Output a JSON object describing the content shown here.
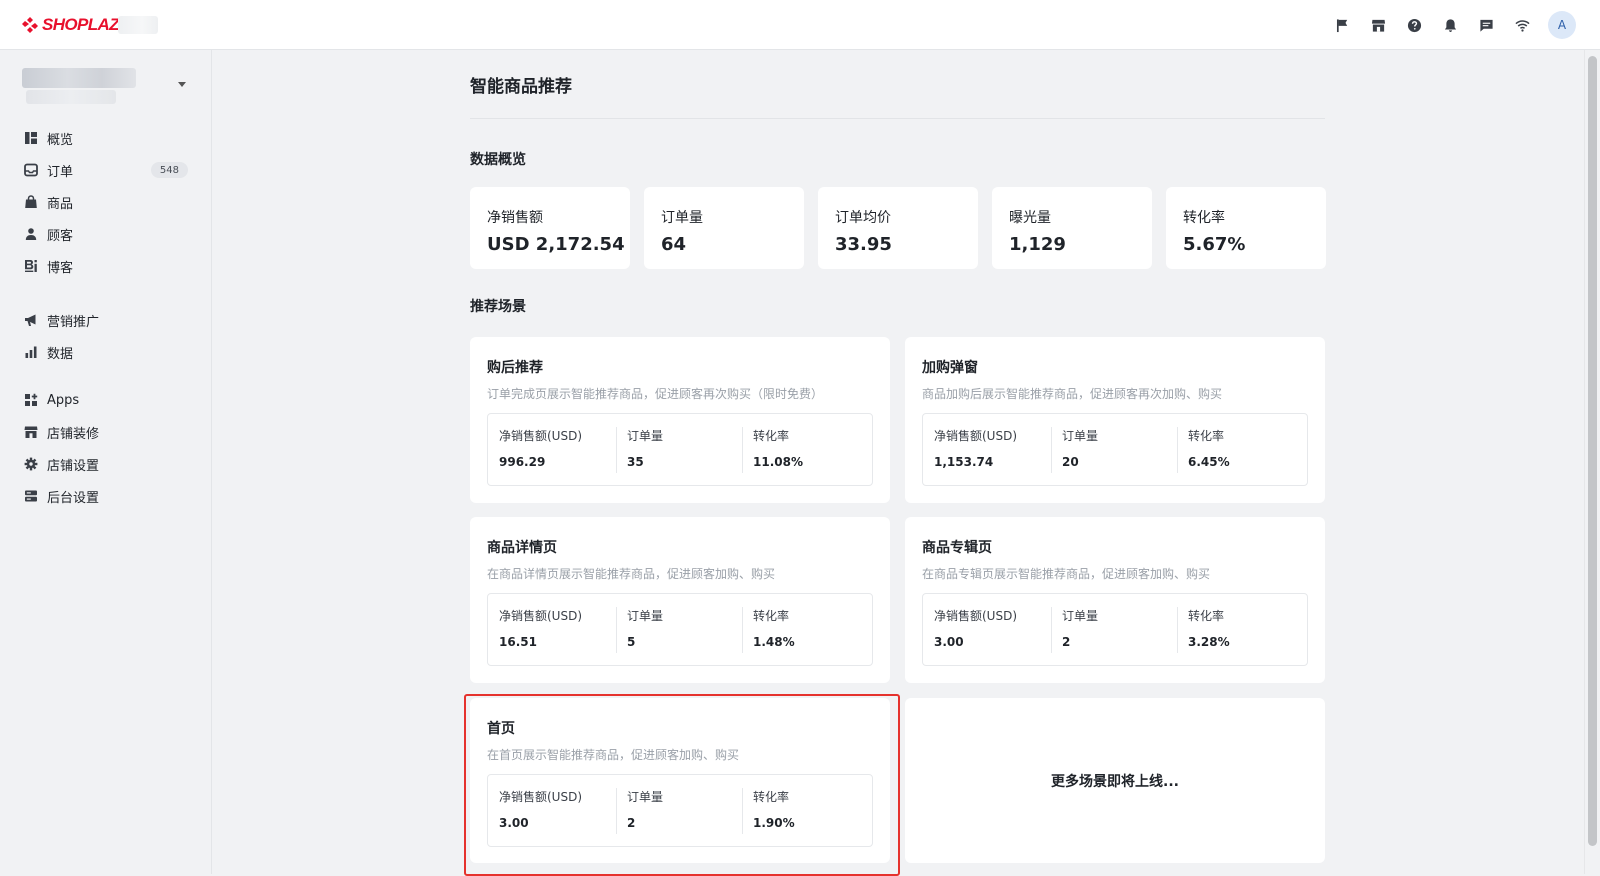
{
  "header": {
    "logo_text": "SHOPLAZZA",
    "brand_color": "#e8112d",
    "icons": [
      "flag-icon",
      "store-icon",
      "help-icon",
      "bell-icon",
      "chat-icon",
      "wifi-icon"
    ],
    "avatar_initial": "A"
  },
  "sidebar": {
    "groups": [
      [
        {
          "label": "概览",
          "icon": "overview-icon"
        },
        {
          "label": "订单",
          "icon": "inbox-icon",
          "badge": "548"
        },
        {
          "label": "商品",
          "icon": "bag-icon"
        },
        {
          "label": "顾客",
          "icon": "person-icon"
        },
        {
          "label": "博客",
          "icon": "blog-icon"
        }
      ],
      [
        {
          "label": "营销推广",
          "icon": "megaphone-icon"
        },
        {
          "label": "数据",
          "icon": "bar-chart-icon"
        }
      ],
      [
        {
          "label": "Apps",
          "icon": "apps-icon"
        },
        {
          "label": "店铺装修",
          "icon": "storefront-icon"
        },
        {
          "label": "店铺设置",
          "icon": "gear-icon"
        },
        {
          "label": "后台设置",
          "icon": "server-icon"
        }
      ]
    ]
  },
  "main": {
    "title": "智能商品推荐",
    "overview": {
      "title": "数据概览",
      "metrics": [
        {
          "label": "净销售额",
          "value": "USD 2,172.54"
        },
        {
          "label": "订单量",
          "value": "64"
        },
        {
          "label": "订单均价",
          "value": "33.95"
        },
        {
          "label": "曝光量",
          "value": "1,129"
        },
        {
          "label": "转化率",
          "value": "5.67%"
        }
      ]
    },
    "scenes": {
      "title": "推荐场景",
      "items": [
        {
          "title": "购后推荐",
          "desc": "订单完成页展示智能推荐商品，促进顾客再次购买（限时免费）",
          "stats": [
            {
              "label": "净销售额(USD)",
              "value": "996.29"
            },
            {
              "label": "订单量",
              "value": "35"
            },
            {
              "label": "转化率",
              "value": "11.08%"
            }
          ]
        },
        {
          "title": "加购弹窗",
          "desc": "商品加购后展示智能推荐商品，促进顾客再次加购、购买",
          "stats": [
            {
              "label": "净销售额(USD)",
              "value": "1,153.74"
            },
            {
              "label": "订单量",
              "value": "20"
            },
            {
              "label": "转化率",
              "value": "6.45%"
            }
          ]
        },
        {
          "title": "商品详情页",
          "desc": "在商品详情页展示智能推荐商品，促进顾客加购、购买",
          "stats": [
            {
              "label": "净销售额(USD)",
              "value": "16.51"
            },
            {
              "label": "订单量",
              "value": "5"
            },
            {
              "label": "转化率",
              "value": "1.48%"
            }
          ]
        },
        {
          "title": "商品专辑页",
          "desc": "在商品专辑页展示智能推荐商品，促进顾客加购、购买",
          "stats": [
            {
              "label": "净销售额(USD)",
              "value": "3.00"
            },
            {
              "label": "订单量",
              "value": "2"
            },
            {
              "label": "转化率",
              "value": "3.28%"
            }
          ]
        },
        {
          "title": "首页",
          "desc": "在首页展示智能推荐商品，促进顾客加购、购买",
          "stats": [
            {
              "label": "净销售额(USD)",
              "value": "3.00"
            },
            {
              "label": "订单量",
              "value": "2"
            },
            {
              "label": "转化率",
              "value": "1.90%"
            }
          ]
        }
      ],
      "coming_soon": "更多场景即将上线..."
    }
  },
  "colors": {
    "highlight": "#e5322d",
    "page_bg": "#f1f2f4",
    "card_bg": "#ffffff",
    "muted_text": "#9aa0a8"
  }
}
